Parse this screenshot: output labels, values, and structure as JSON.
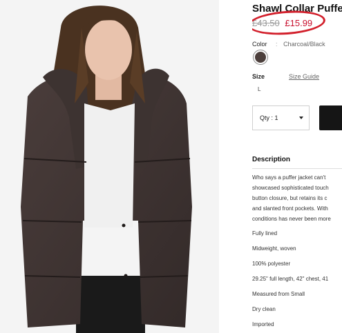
{
  "product": {
    "title": "Shawl Collar Puffer Jacket",
    "price_original": "£43.50",
    "price_sale": "£15.99"
  },
  "color": {
    "label": "Color",
    "separator": ":",
    "value": "Charcoal/Black",
    "swatch_hex": "#4c3f3c"
  },
  "size": {
    "label": "Size",
    "guide_link": "Size Guide",
    "selected": "L"
  },
  "quantity": {
    "label": "Qty : 1"
  },
  "annotation": {
    "circle_color": "#d21f2b"
  },
  "description": {
    "heading": "Description",
    "lines": [
      "Who says a puffer jacket can't",
      "showcased sophisticated touch",
      "button closure, but retains its c",
      "and slanted front pockets. With",
      "conditions has never been more"
    ],
    "details": [
      "Fully lined",
      "Midweight, woven",
      "100% polyester",
      "29.25\" full length, 42\" chest, 41",
      "Measured from Small",
      "Dry clean",
      "Imported"
    ]
  }
}
